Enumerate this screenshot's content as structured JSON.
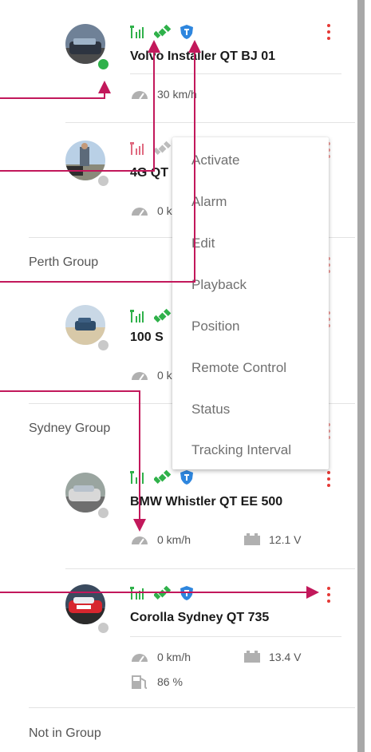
{
  "colors": {
    "accent": "#c2185b",
    "online": "#2fb14a",
    "offline": "#c9c9c9",
    "kebab": "#e53935",
    "shield": "#2e86de",
    "scrollbar": "#a8a8a8"
  },
  "vehicles": [
    {
      "name": "Volvo Installer QT BJ 01",
      "status": "online",
      "speed": "30 km/h"
    },
    {
      "name": "4G QT",
      "status": "offline",
      "speed": "0 k"
    },
    {
      "name": "100 S",
      "status": "offline",
      "speed": "0 k"
    },
    {
      "name": "BMW Whistler QT EE 500",
      "status": "offline",
      "speed": "0 km/h",
      "voltage": "12.1 V"
    },
    {
      "name": "Corolla Sydney QT 735",
      "status": "offline",
      "speed": "0 km/h",
      "voltage": "13.4 V",
      "fuel": "86 %"
    }
  ],
  "groups": {
    "perth": "Perth Group",
    "sydney": "Sydney Group",
    "none": "Not in Group"
  },
  "menu": {
    "items": [
      "Activate",
      "Alarm",
      "Edit",
      "Playback",
      "Position",
      "Remote Control",
      "Status",
      "Tracking Interval"
    ]
  },
  "icons": {
    "signal": "signal-icon",
    "gps": "satellite-icon",
    "shield": "shield-icon",
    "speed": "speedometer-icon",
    "battery": "battery-icon",
    "fuel": "fuel-pump-icon",
    "more": "more-vert-icon"
  }
}
